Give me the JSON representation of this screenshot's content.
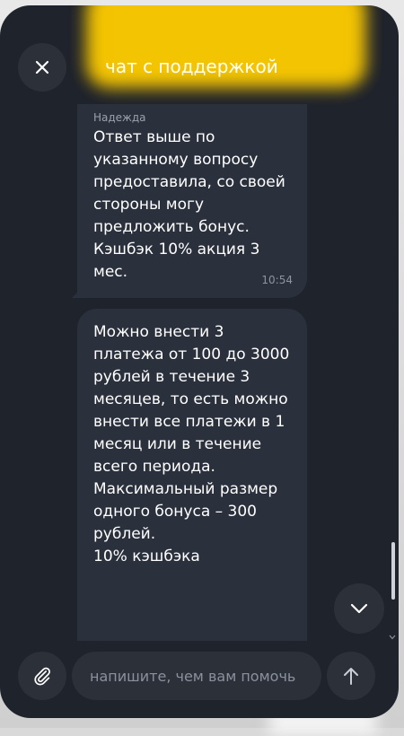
{
  "header": {
    "title": "чат с поддержкой",
    "close_icon": "close-icon",
    "accent_color": "#ffcd00"
  },
  "messages": [
    {
      "sender": "Надежда",
      "text": "Ответ выше по указанному вопросу предоставила, со своей стороны могу предложить бонус. Кэшбэк 10% акция 3 мес.",
      "time": "10:54"
    },
    {
      "text": "Можно внести 3 платежа от 100 до 3000 рублей в течение 3 месяцев, то есть можно внести все платежи в 1 месяц или в течение всего периода.\nМаксимальный размер одного бонуса – 300 рублей.\n10% кэшбэка"
    }
  ],
  "composer": {
    "placeholder": "напишите, чем вам помочь",
    "value": "",
    "attach_icon": "paperclip-icon",
    "send_icon": "arrow-up-icon"
  },
  "scroll": {
    "down_icon": "chevron-down-icon"
  },
  "colors": {
    "panel_bg": "#1f232b",
    "bubble_bg": "#2b313c",
    "button_bg": "#2b3039"
  }
}
